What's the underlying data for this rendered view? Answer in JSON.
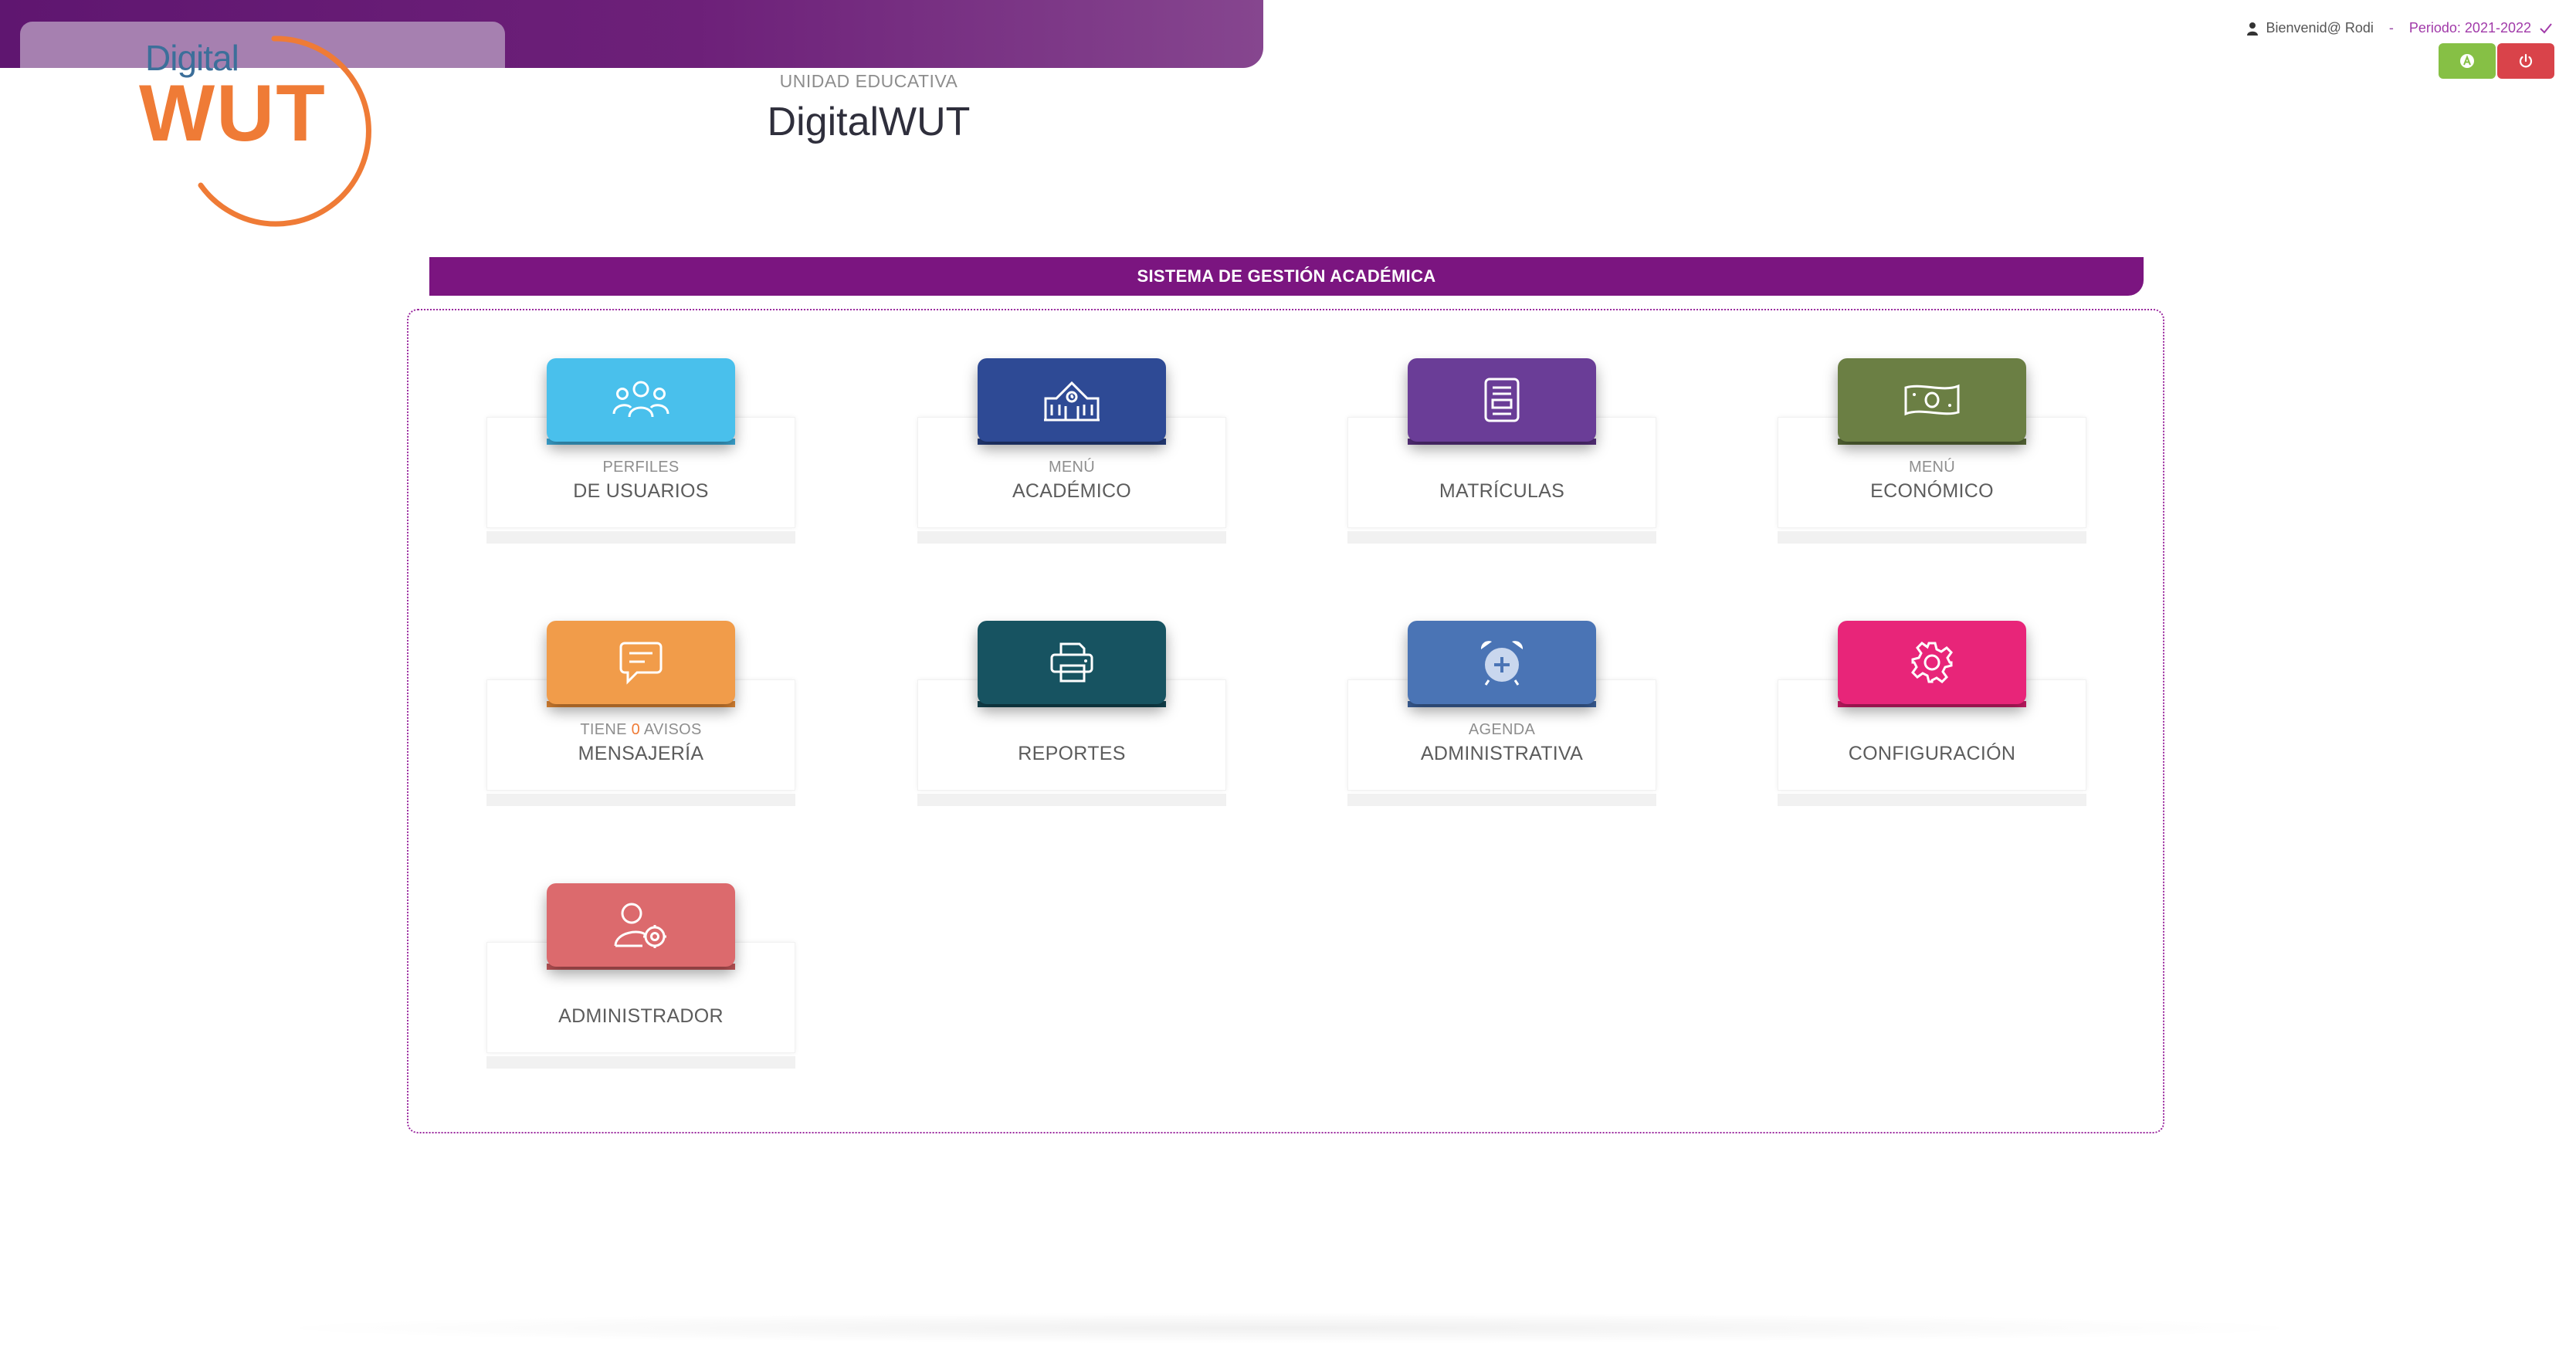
{
  "header": {
    "logo_digital": "Digital",
    "logo_wut": "WUT",
    "institution_label": "UNIDAD EDUCATIVA",
    "institution_name": "DigitalWUT"
  },
  "userbar": {
    "welcome": "Bienvenid@ Rodi",
    "separator": "-",
    "period": "Periodo: 2021-2022"
  },
  "section_title": "SISTEMA DE GESTIÓN ACADÉMICA",
  "tiles": [
    {
      "sub": "PERFILES",
      "title": "DE USUARIOS",
      "color": "#49c0ec",
      "base": "#3fb0e0",
      "icon": "users-icon"
    },
    {
      "sub": "MENÚ",
      "title": "ACADÉMICO",
      "color": "#2e4a95",
      "base": "#263f80",
      "icon": "school-building-icon"
    },
    {
      "sub": "",
      "title": "MATRÍCULAS",
      "color": "#6a3d97",
      "base": "#5b3283",
      "icon": "document-icon"
    },
    {
      "sub": "MENÚ",
      "title": "ECONÓMICO",
      "color": "#6b7f44",
      "base": "#5c6e3a",
      "icon": "banknote-icon"
    },
    {
      "sub_prefix": "TIENE",
      "sub_count": "0",
      "sub_suffix": "AVISOS",
      "title": "MENSAJERÍA",
      "color": "#f19c4a",
      "base": "#e58a35",
      "icon": "message-icon"
    },
    {
      "sub": "",
      "title": "REPORTES",
      "color": "#175361",
      "base": "#124552",
      "icon": "printer-icon"
    },
    {
      "sub": "AGENDA",
      "title": "ADMINISTRATIVA",
      "color": "#4a74b5",
      "base": "#3d64a0",
      "icon": "alarm-clock-icon"
    },
    {
      "sub": "",
      "title": "CONFIGURACIÓN",
      "color": "#e82579",
      "base": "#d11c6a",
      "icon": "gear-icon"
    },
    {
      "sub": "",
      "title": "ADMINISTRADOR",
      "color": "#dc6a6d",
      "base": "#c95a5d",
      "icon": "user-settings-icon"
    }
  ]
}
